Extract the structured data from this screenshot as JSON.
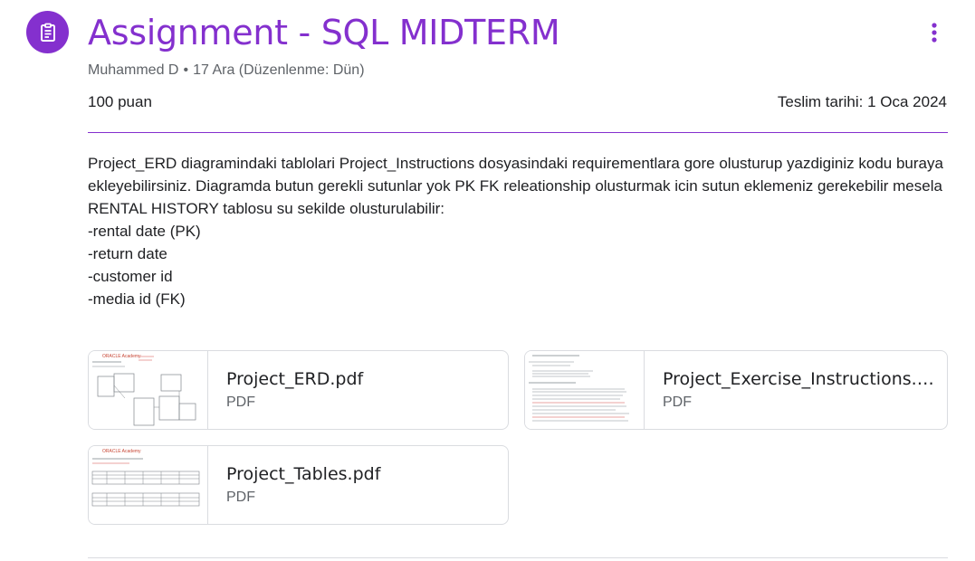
{
  "assignment": {
    "icon": "assignment-icon",
    "title": "Assignment - SQL MIDTERM",
    "author": "Muhammed D",
    "meta_separator": "•",
    "date": "17 Ara (Düzenlenme: Dün)",
    "points": "100 puan",
    "due": "Teslim tarihi: 1 Oca 2024",
    "more_icon": "more-vert-icon",
    "accent_color": "#8430ce"
  },
  "description": [
    "Project_ERD diagramindaki tablolari Project_Instructions dosyasindaki requirementlara gore olusturup yazdiginiz kodu buraya ekleyebilirsiniz. Diagramda butun gerekli sutunlar yok PK FK releationship olusturmak icin sutun eklemeniz gerekebilir mesela",
    "RENTAL HISTORY tablosu su sekilde olusturulabilir:",
    "-rental date (PK)",
    "-return date",
    "-customer id",
    "-media id (FK)"
  ],
  "attachments": [
    {
      "name": "Project_ERD.pdf",
      "type": "PDF",
      "thumb_logo": "ORACLE Academy"
    },
    {
      "name": "Project_Exercise_Instructions.pdf",
      "type": "PDF",
      "thumb_logo": ""
    },
    {
      "name": "Project_Tables.pdf",
      "type": "PDF",
      "thumb_logo": "ORACLE Academy"
    }
  ]
}
